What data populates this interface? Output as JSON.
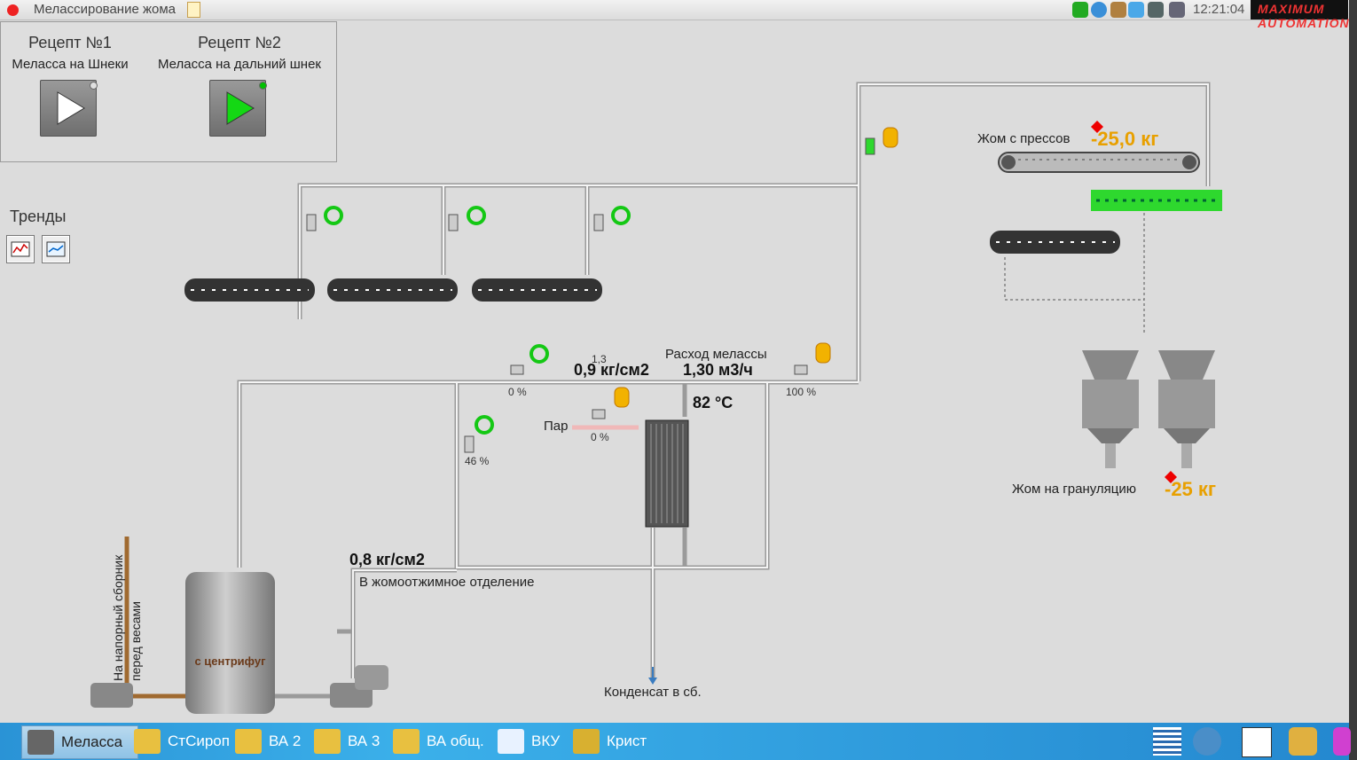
{
  "window": {
    "title": "Мелассирование жома",
    "clock": "12:21:04",
    "logo": "MAXIMUM AUTOMATION"
  },
  "recipes": [
    {
      "title": "Рецепт №1",
      "subtitle": "Меласса на Шнеки",
      "indicator": "#e0e0e0"
    },
    {
      "title": "Рецепт №2",
      "subtitle": "Меласса на дальний шнек",
      "indicator": "#00c000"
    }
  ],
  "trends": {
    "label": "Тренды"
  },
  "process": {
    "press_label": "Жом с прессов",
    "press_weight": "-25,0 кг",
    "granulation_label": "Жом на грануляцию",
    "granulation_weight": "-25 кг",
    "flow_label": "Расход мелассы",
    "flow_value": "1,30 м3/ч",
    "pressure_main": "0,9 кг/см2",
    "pressure_set": "1,3",
    "pressure_outlet": "0,8 кг/см2",
    "temperature": "82 °C",
    "steam_label": "Пар",
    "valve_a_pct": "0 %",
    "valve_b_pct": "100 %",
    "valve_steam_pct": "0 %",
    "valve_c_pct": "46 %",
    "outlet_label": "В жомоотжимное отделение",
    "condensate_label": "Конденсат в сб.",
    "tank_label": "с центрифуг",
    "pipe_label_1": "На напорный сборник",
    "pipe_label_2": "перед весами"
  },
  "taskbar": [
    {
      "label": "Меласса",
      "active": true
    },
    {
      "label": "СтСироп",
      "active": false
    },
    {
      "label": "ВА 2",
      "active": false
    },
    {
      "label": "ВА 3",
      "active": false
    },
    {
      "label": "ВА общ.",
      "active": false
    },
    {
      "label": "ВКУ",
      "active": false
    },
    {
      "label": "Крист",
      "active": false
    }
  ],
  "colors": {
    "pipe": "#f4f4f4",
    "run": "#00c000",
    "manual": "#f0b000",
    "alarm": "#e00000"
  }
}
